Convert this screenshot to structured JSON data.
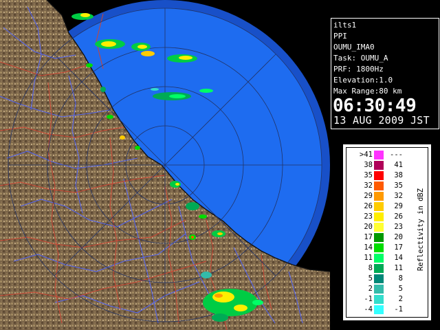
{
  "info": {
    "lines": [
      "ilts1",
      "PPI",
      "OUMU_IMA0",
      "Task: OUMU_A",
      "PRF: 1800Hz",
      "Elevation:1.0",
      "Max Range:80 km"
    ],
    "time": "06:30:49",
    "date": "13 AUG 2009 JST"
  },
  "legend": {
    "title": "Reflectivity in dBZ",
    "rows": [
      {
        "left": ">41",
        "right": "---",
        "color": "#ff33ff"
      },
      {
        "left": "38",
        "right": "41",
        "color": "#b00058"
      },
      {
        "left": "35",
        "right": "38",
        "color": "#ff0000"
      },
      {
        "left": "32",
        "right": "35",
        "color": "#ff5a00"
      },
      {
        "left": "29",
        "right": "32",
        "color": "#ff9a00"
      },
      {
        "left": "26",
        "right": "29",
        "color": "#ffcc00"
      },
      {
        "left": "23",
        "right": "26",
        "color": "#ffee00"
      },
      {
        "left": "20",
        "right": "23",
        "color": "#ffff33"
      },
      {
        "left": "17",
        "right": "20",
        "color": "#009900"
      },
      {
        "left": "14",
        "right": "17",
        "color": "#00dd00"
      },
      {
        "left": "11",
        "right": "14",
        "color": "#00ff66"
      },
      {
        "left": "8",
        "right": "11",
        "color": "#00aa55"
      },
      {
        "left": "5",
        "right": "8",
        "color": "#008877"
      },
      {
        "left": "2",
        "right": "5",
        "color": "#33bbaa"
      },
      {
        "left": "-1",
        "right": "2",
        "color": "#33ddcc"
      },
      {
        "left": "-4",
        "right": "-1",
        "color": "#33ffff"
      }
    ]
  },
  "colors": {
    "sea_inner": "#1e6cf0",
    "sea_outer": "#1850c8",
    "land": "#7a6448",
    "rivers": "#5566ee",
    "borders": "#cc4433",
    "range_rings": "#223366"
  }
}
